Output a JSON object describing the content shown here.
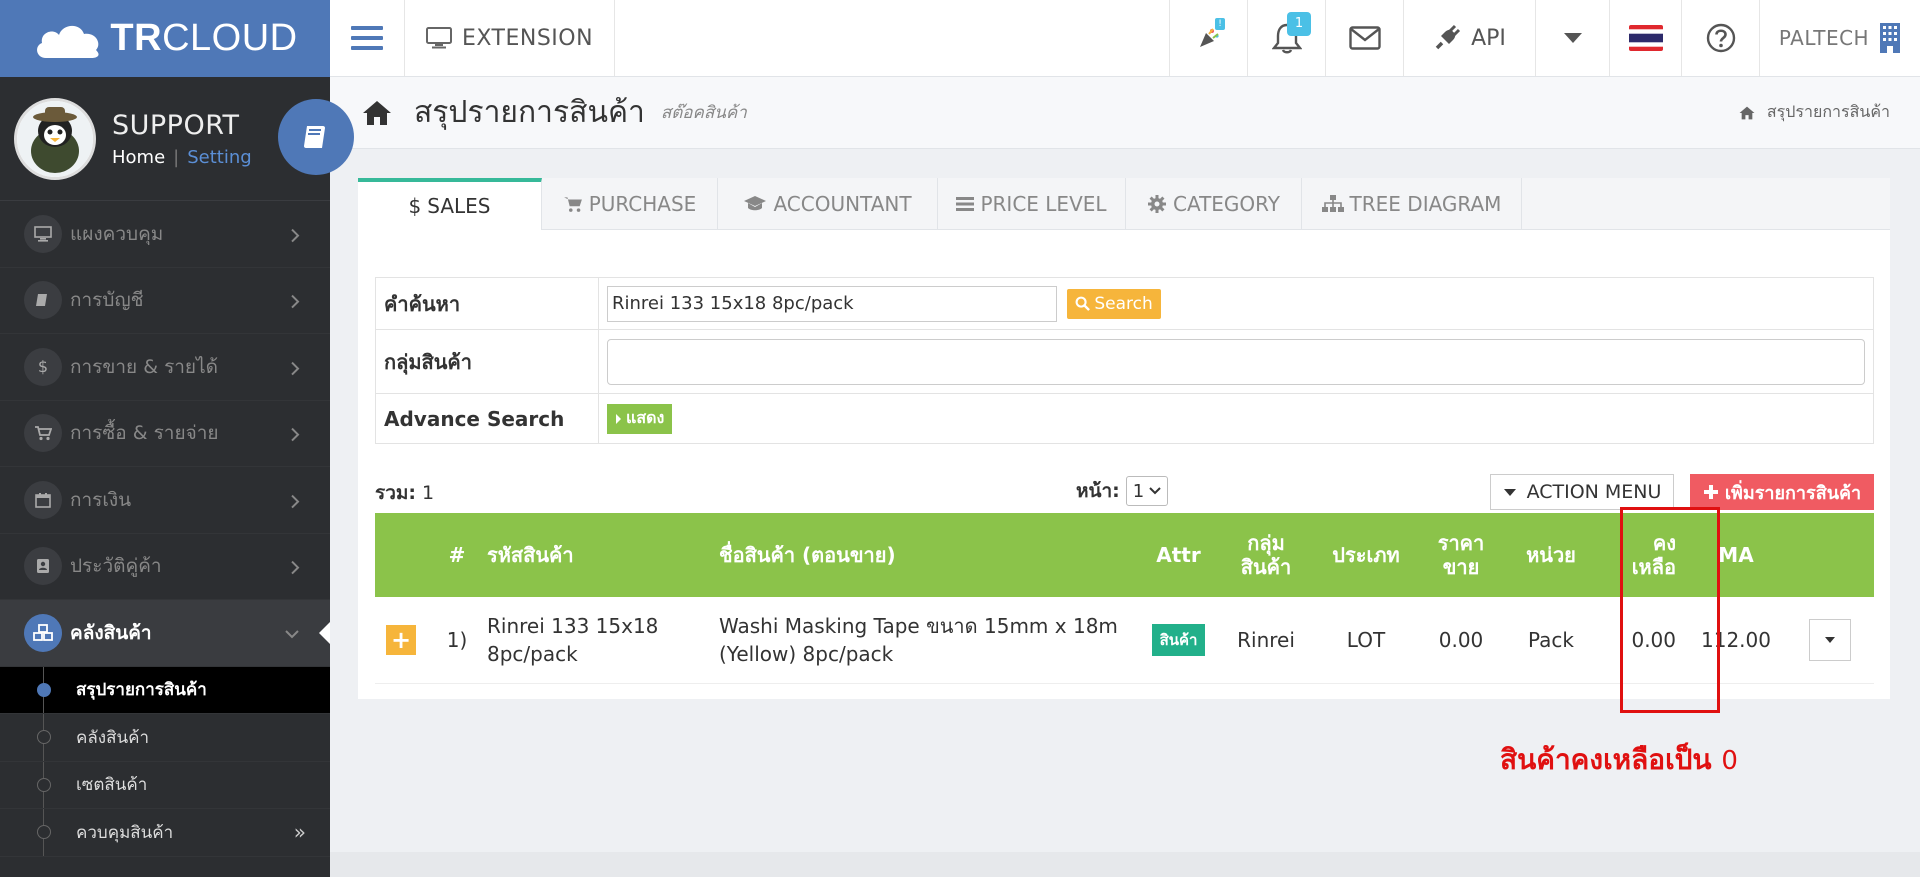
{
  "logo": {
    "bold": "TR",
    "thin": "CLOUD"
  },
  "topbar": {
    "extension_label": "EXTENSION",
    "notification_count": "1",
    "party_badge": "!",
    "api_label": "API",
    "user_label": "PALTECH"
  },
  "profile": {
    "name": "SUPPORT",
    "home_link": "Home",
    "separator": "|",
    "setting_link": "Setting"
  },
  "sidebar": {
    "items": [
      {
        "label": "แผงควบคุม",
        "icon": "monitor-icon"
      },
      {
        "label": "การบัญชี",
        "icon": "book-icon"
      },
      {
        "label": "การขาย & รายได้",
        "icon": "dollar-icon"
      },
      {
        "label": "การซื้อ & รายจ่าย",
        "icon": "cart-icon"
      },
      {
        "label": "การเงิน",
        "icon": "calendar-icon"
      },
      {
        "label": "ประวัติคู่ค้า",
        "icon": "contact-icon"
      },
      {
        "label": "คลังสินค้า",
        "icon": "cubes-icon"
      }
    ],
    "subitems": [
      "สรุปรายการสินค้า",
      "คลังสินค้า",
      "เซตสินค้า",
      "ควบคุมสินค้า"
    ]
  },
  "page": {
    "title": "สรุปรายการสินค้า",
    "subtitle": "สต๊อคสินค้า",
    "breadcrumb": "สรุปรายการสินค้า"
  },
  "tabs": [
    {
      "label": "SALES",
      "icon": "$"
    },
    {
      "label": "PURCHASE"
    },
    {
      "label": "ACCOUNTANT"
    },
    {
      "label": "PRICE LEVEL"
    },
    {
      "label": "CATEGORY"
    },
    {
      "label": "TREE DIAGRAM"
    }
  ],
  "search": {
    "keyword_label": "คำค้นหา",
    "keyword_value": "Rinrei 133 15x18 8pc/pack",
    "search_button": "Search",
    "group_label": "กลุ่มสินค้า",
    "group_value": "",
    "advance_label": "Advance Search",
    "show_button": "แสดง"
  },
  "list": {
    "total_label": "รวม:",
    "total_value": "1",
    "page_label": "หน้า:",
    "page_value": "1",
    "action_menu": "ACTION MENU",
    "add_button": "เพิ่มรายการสินค้า"
  },
  "table": {
    "headers": {
      "num": "#",
      "code": "รหัสสินค้า",
      "name": "ชื่อสินค้า (ตอนขาย)",
      "attr": "Attr",
      "group_1": "กลุ่ม",
      "group_2": "สินค้า",
      "type": "ประเภท",
      "price_1": "ราคา",
      "price_2": "ขาย",
      "unit": "หน่วย",
      "remain_1": "คง",
      "remain_2": "เหลือ",
      "ma": "MA"
    },
    "rows": [
      {
        "num": "1)",
        "code_1": "Rinrei 133 15x18",
        "code_2": "8pc/pack",
        "name_1": "Washi Masking Tape ขนาด 15mm x 18m",
        "name_2": "(Yellow) 8pc/pack",
        "attr": "สินค้า",
        "group": "Rinrei",
        "type": "LOT",
        "price": "0.00",
        "unit": "Pack",
        "remain": "0.00",
        "ma": "112.00"
      }
    ]
  },
  "annotation": {
    "text": "สินค้าคงเหลือเป็น",
    "value": "0"
  },
  "colors": {
    "brand": "#4f78b7",
    "green": "#8bc34a",
    "orange": "#f6b53b",
    "red": "#f05b62",
    "teal": "#36b999",
    "sidebar": "#2c2e31"
  }
}
